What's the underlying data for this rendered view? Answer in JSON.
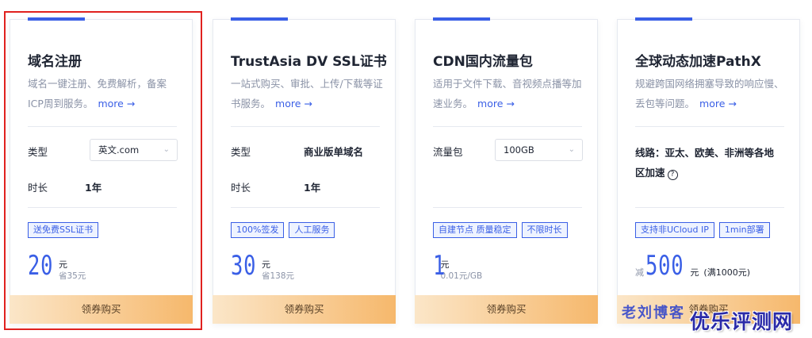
{
  "colors": {
    "accent": "#3a5fe6",
    "buy_gradient_start": "#fbe6c8",
    "buy_gradient_end": "#f6b86c",
    "selection": "#e0211f"
  },
  "cards": [
    {
      "title": "域名注册",
      "desc": "域名一键注册、免费解析，备案ICP周到服务。",
      "more": "more →",
      "row1": {
        "label": "类型",
        "select": "英文.com"
      },
      "row2": {
        "label": "时长",
        "value": "1年"
      },
      "tags": [
        "送免费SSL证书"
      ],
      "price": {
        "num": "20",
        "unit": "元",
        "save": "省35元"
      },
      "buy": "领券购买"
    },
    {
      "title": "TrustAsia DV SSL证书",
      "desc": "一站式购买、审批、上传/下载等证书服务。",
      "more": "more →",
      "row1": {
        "label": "类型",
        "value": "商业版单域名"
      },
      "row2": {
        "label": "时长",
        "value": "1年"
      },
      "tags": [
        "100%签发",
        "人工服务"
      ],
      "price": {
        "num": "30",
        "unit": "元",
        "save": "省138元"
      },
      "buy": "领券购买"
    },
    {
      "title": "CDN国内流量包",
      "desc": "适用于文件下载、音视频点播等加速业务。",
      "more": "more →",
      "row1": {
        "label": "流量包",
        "select": "100GB"
      },
      "tags": [
        "自建节点 质量稳定",
        "不限时长"
      ],
      "price": {
        "num": "1",
        "unit": "元",
        "save": "0.01元/GB"
      },
      "buy": "领券购买"
    },
    {
      "title": "全球动态加速PathX",
      "desc": "规避跨国网络拥塞导致的响应慢、丢包等问题。",
      "more": "more →",
      "line_label": "线路：亚太、欧美、非洲等各地区加速",
      "help": "?",
      "tags": [
        "支持非UCloud IP",
        "1min部署"
      ],
      "price": {
        "prefix": "减",
        "num": "500",
        "unit": "元",
        "after": "(满1000元)"
      },
      "buy": "领券购买"
    }
  ],
  "watermark": {
    "text1": "老刘博客",
    "text2": "优乐评测网"
  }
}
